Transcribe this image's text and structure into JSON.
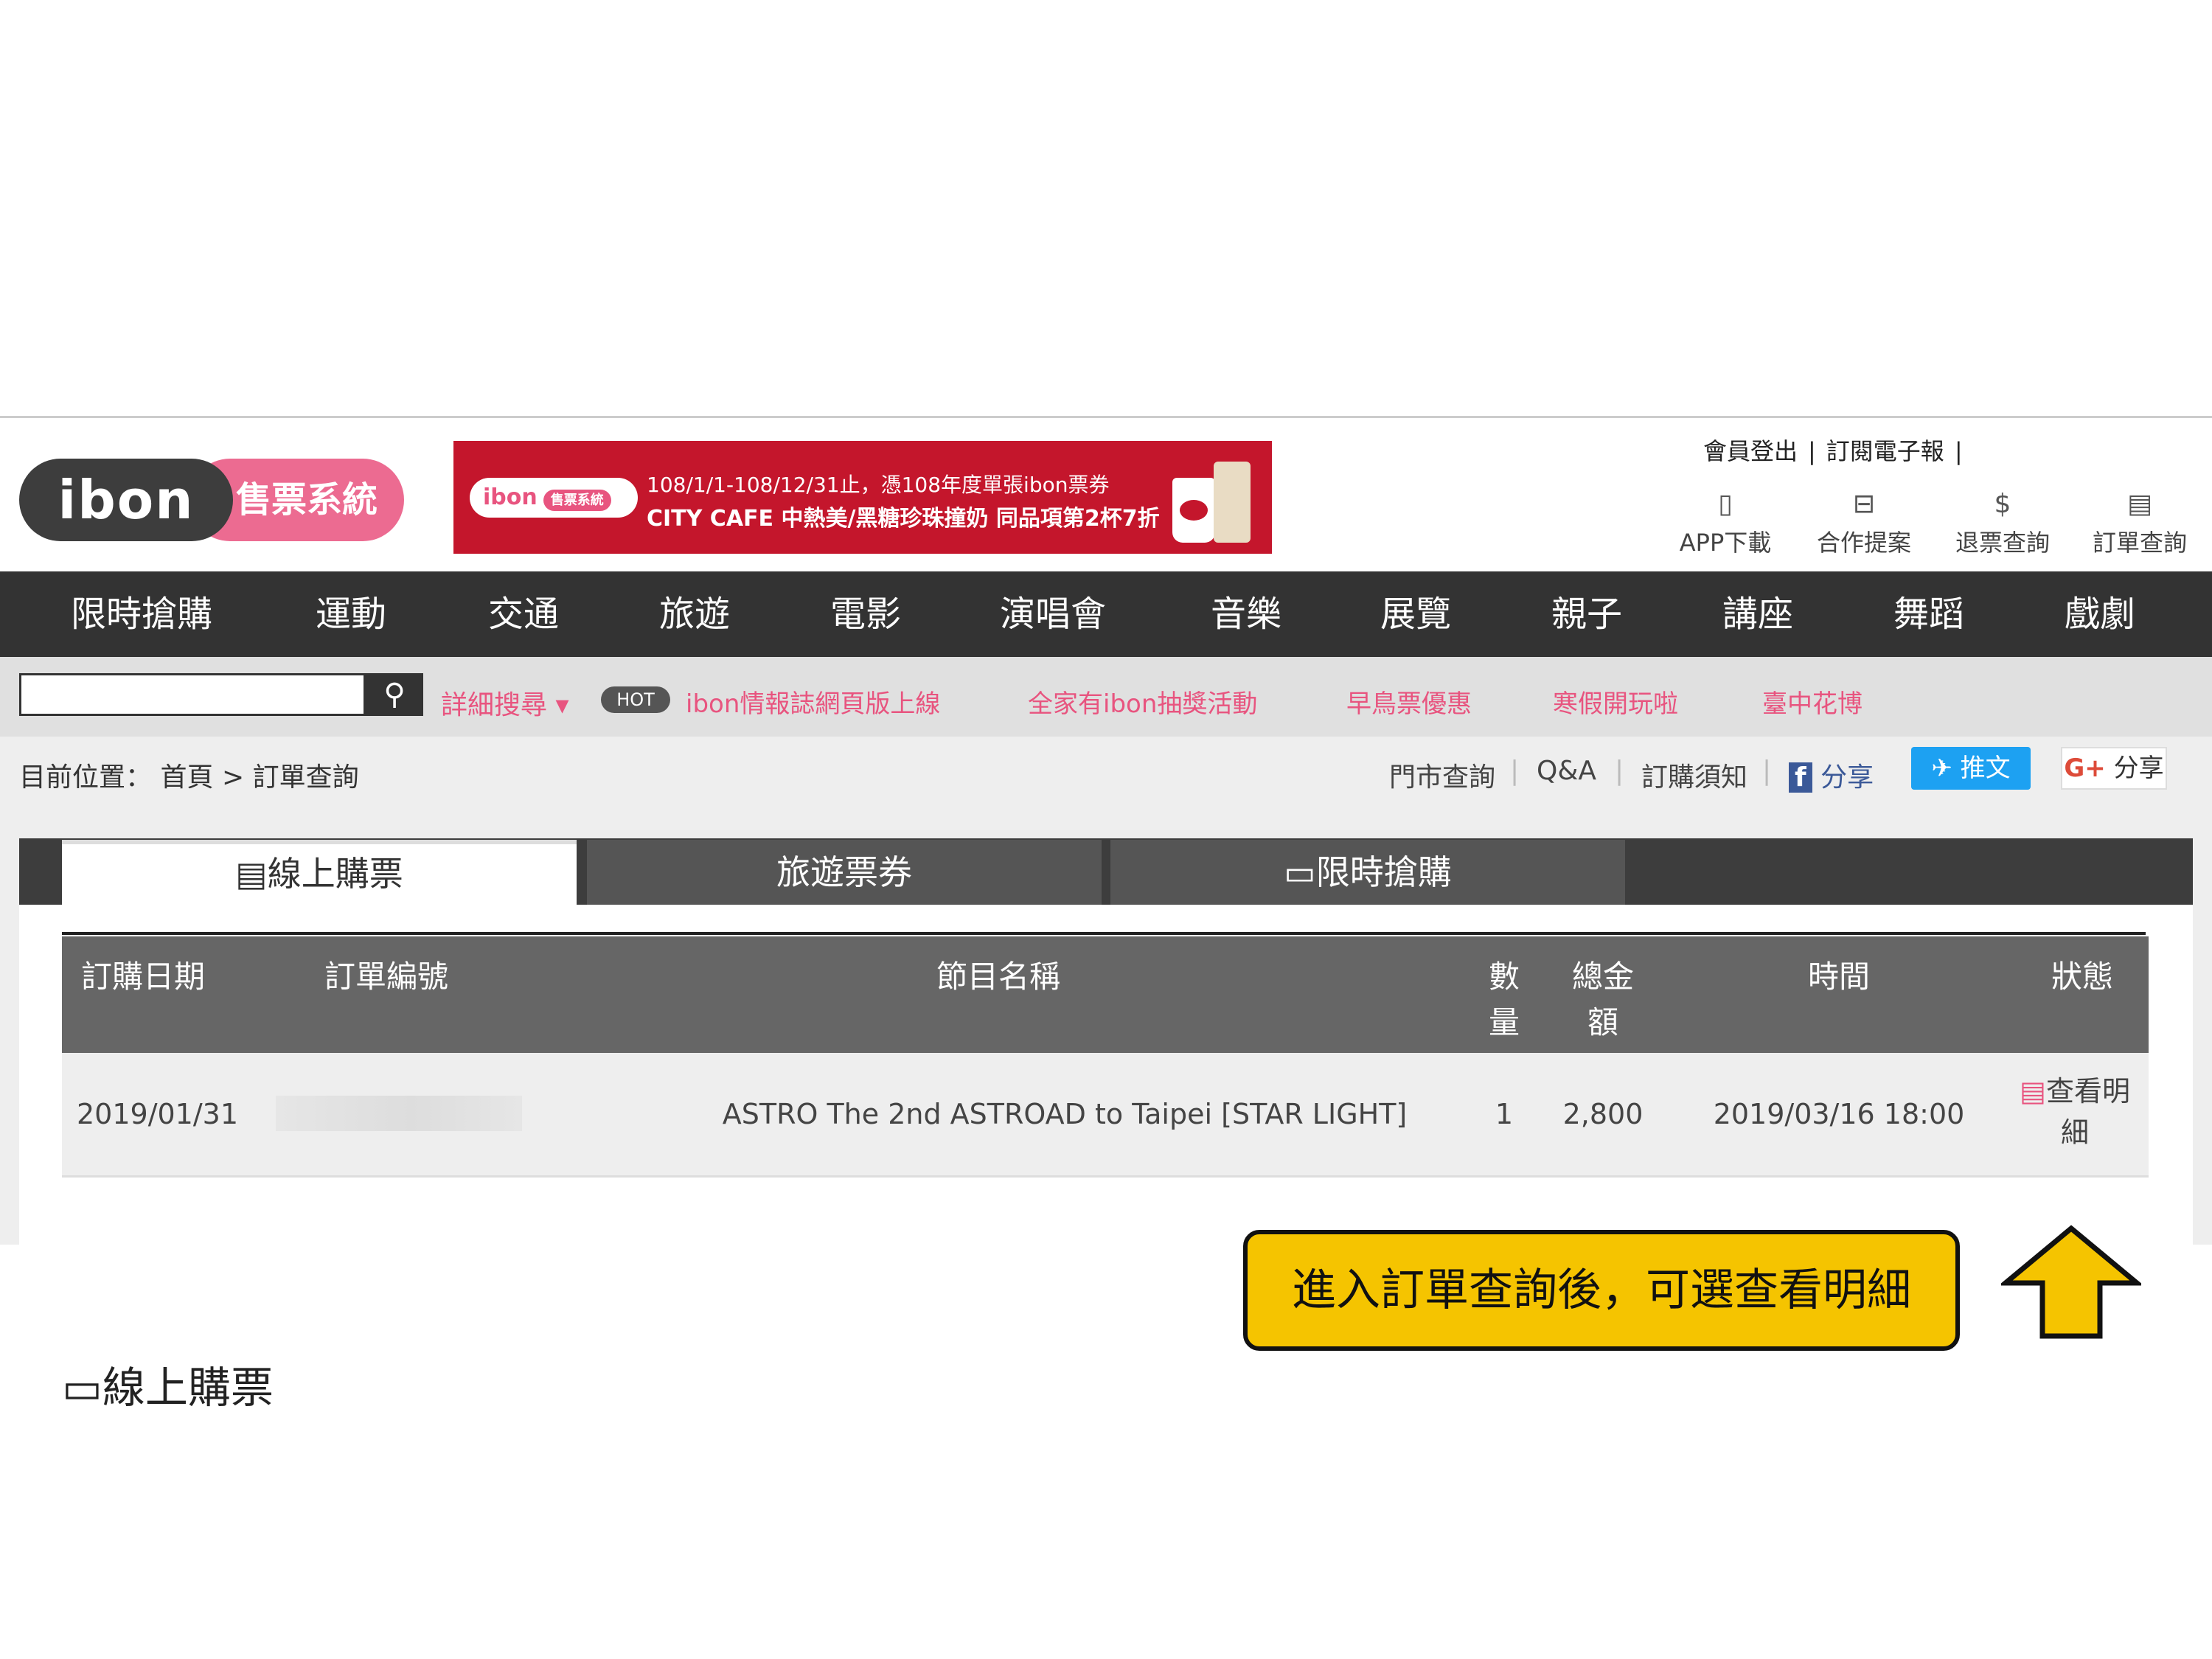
{
  "header": {
    "logo_text": "ibon",
    "logo_sub": "售票系統",
    "banner": {
      "pill_text": "ibon",
      "pill_sub": "售票系統",
      "line1": "108/1/1-108/12/31止，憑108年度單張ibon票券",
      "line2": "CITY CAFE 中熱美/黑糖珍珠撞奶 同品項第2杯7折"
    },
    "top_links": [
      "會員登出",
      "訂閱電子報"
    ],
    "top_sep": "|",
    "tools": [
      {
        "label": "APP下載",
        "icon": "phone-icon"
      },
      {
        "label": "合作提案",
        "icon": "briefcase-icon"
      },
      {
        "label": "退票查詢",
        "icon": "refund-icon"
      },
      {
        "label": "訂單查詢",
        "icon": "document-icon"
      }
    ]
  },
  "nav": [
    "限時搶購",
    "運動",
    "交通",
    "旅遊",
    "電影",
    "演唱會",
    "音樂",
    "展覽",
    "親子",
    "講座",
    "舞蹈",
    "戲劇"
  ],
  "search": {
    "placeholder": "",
    "advanced": "詳細搜尋",
    "hot_badge": "HOT",
    "promos": [
      "ibon情報誌網頁版上線",
      "全家有ibon抽獎活動",
      "早鳥票優惠",
      "寒假開玩啦",
      "臺中花博"
    ]
  },
  "breadcrumb": {
    "prefix": "目前位置：",
    "home": "首頁",
    "arrow": ">",
    "current": "訂單查詢"
  },
  "right_links": {
    "store": "門市查詢",
    "qa": "Q&A",
    "notice": "訂購須知",
    "fb_share": "分享",
    "tweet": "推文",
    "gplus_share": "分享",
    "sep": "|"
  },
  "tabs": [
    "線上購票",
    "旅遊票券",
    "限時搶購"
  ],
  "section_title": "線上購票",
  "table": {
    "headers": {
      "date": "訂購日期",
      "order_no": "訂單編號",
      "program": "節目名稱",
      "qty_1": "數",
      "qty_2": "量",
      "total_1": "總金",
      "total_2": "額",
      "time": "時間",
      "status": "狀態"
    },
    "rows": [
      {
        "date": "2019/01/31",
        "order_no": "",
        "program": "ASTRO The 2nd ASTROAD to Taipei [STAR LIGHT]",
        "qty": "1",
        "total": "2,800",
        "time": "2019/03/16 18:00",
        "status_1": "查看明",
        "status_2": "細"
      }
    ]
  },
  "callout": "進入訂單查詢後，可選查看明細",
  "colors": {
    "brand_pink": "#e8547f",
    "nav_dark": "#333333",
    "callout_yellow": "#f5c400",
    "twitter_blue": "#1da1f2"
  }
}
